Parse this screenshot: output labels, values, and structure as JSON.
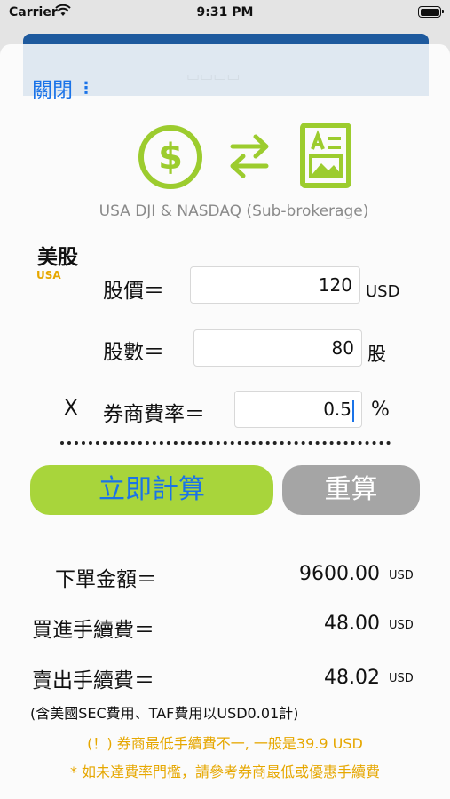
{
  "status": {
    "carrier": "Carrier",
    "time": "9:31 PM"
  },
  "header": {
    "close_label": "關閉",
    "subtitle": "USA DJI & NASDAQ (Sub-brokerage)"
  },
  "icons": {
    "coin": "dollar-coin-icon",
    "swap": "swap-arrows-icon",
    "doc": "document-icon"
  },
  "market": {
    "title": "美股",
    "tag": "USA"
  },
  "form": {
    "price_label": "股價＝",
    "price_value": "120",
    "price_unit": "USD",
    "qty_label": "股數＝",
    "qty_value": "80",
    "qty_unit": "股",
    "multiply": "X",
    "rate_label": "券商費率＝",
    "rate_value": "0.5",
    "rate_unit": "%"
  },
  "buttons": {
    "calculate": "立即計算",
    "reset": "重算"
  },
  "results": {
    "order_label": "下單金額＝",
    "order_value": "9600.00",
    "order_unit": "USD",
    "buy_label": "買進手續費＝",
    "buy_value": "48.00",
    "buy_unit": "USD",
    "sell_label": "賣出手續費＝",
    "sell_value": "48.02",
    "sell_unit": "USD"
  },
  "notes": {
    "sec_note": "(含美國SEC費用、TAF費用以USD0.01計)",
    "min_fee": "(！) 券商最低手續費不一, 一般是39.9 USD",
    "threshold": "* 如未達費率門檻，請參考券商最低或優惠手續費"
  },
  "colors": {
    "accent": "#9ccc2e",
    "link": "#1a73e8",
    "warning": "#e6a700",
    "reset": "#a5a5a5"
  }
}
